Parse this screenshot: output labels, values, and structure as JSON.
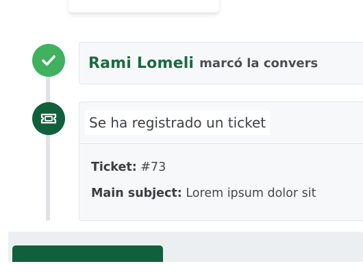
{
  "timeline": {
    "events": [
      {
        "icon": "check-icon",
        "actor": "Rami Lomeli",
        "action": "marcó la convers"
      },
      {
        "icon": "ticket-icon",
        "title": "Se ha registrado un ticket",
        "details": [
          {
            "label": "Ticket:",
            "value": "#73"
          },
          {
            "label": "Main subject:",
            "value": "Lorem ipsum dolor sit"
          }
        ]
      }
    ]
  },
  "colors": {
    "brand_dark_green": "#12603b",
    "success_green": "#3fb15f",
    "actor_green": "#1a6b40"
  }
}
